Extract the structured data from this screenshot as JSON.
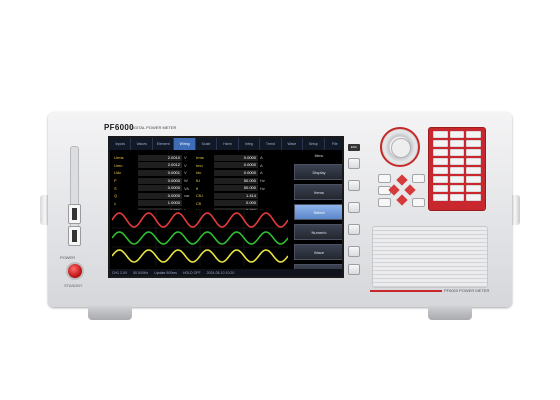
{
  "device": {
    "model": "PF6000",
    "subtitle": "DIGITAL POWER METER",
    "brand_logo": "",
    "power_label": "POWER",
    "standby_label": "STANDBY",
    "usb_label": "USB",
    "footer_model": "PF6000 POWER METER"
  },
  "screen": {
    "tabs": [
      "Inputs",
      "Values",
      "Element",
      "Wiring",
      "Scale",
      "Harm",
      "Integ",
      "Trend",
      "Wave",
      "Setup",
      "File"
    ],
    "active_tab": 3,
    "measurements": [
      {
        "label": "Urms",
        "value": "2.0010",
        "unit": "V",
        "label2": "Irms",
        "value2": "0.0000",
        "unit2": "A"
      },
      {
        "label": "Umn",
        "value": "2.0012",
        "unit": "V",
        "label2": "Imn",
        "value2": "0.0000",
        "unit2": "A"
      },
      {
        "label": "Udc",
        "value": "0.0001",
        "unit": "V",
        "label2": "Idc",
        "value2": "0.0000",
        "unit2": "A"
      },
      {
        "label": "P",
        "value": "0.0000",
        "unit": "W",
        "label2": "fU",
        "value2": "50.000",
        "unit2": "Hz"
      },
      {
        "label": "S",
        "value": "0.0000",
        "unit": "VA",
        "label2": "fI",
        "value2": "50.000",
        "unit2": "Hz"
      },
      {
        "label": "Q",
        "value": "0.0000",
        "unit": "var",
        "label2": "CfU",
        "value2": "1.414",
        "unit2": ""
      },
      {
        "label": "λ",
        "value": "1.0000",
        "unit": "",
        "label2": "CfI",
        "value2": "0.000",
        "unit2": ""
      },
      {
        "label": "φ",
        "value": "0.000",
        "unit": "°",
        "label2": "Upk",
        "value2": "2.830",
        "unit2": "V"
      }
    ],
    "side_header": "Menu",
    "side_buttons": [
      "Display",
      "Items",
      "Select",
      "Numeric",
      "Wave",
      "Trend"
    ],
    "side_active": 2,
    "side_footer": "1/2",
    "status_items": [
      "CH1 2.0V",
      "50.000Hz",
      "Update 500ms",
      "HOLD OFF",
      "2024-05-10 10:20"
    ]
  },
  "waves": [
    {
      "color": "#e23b3b",
      "amplitude": 7,
      "cycles": 6
    },
    {
      "color": "#2fbf2f",
      "amplitude": 6,
      "cycles": 6
    },
    {
      "color": "#e7e342",
      "amplitude": 6,
      "cycles": 6
    }
  ],
  "colors": {
    "accent": "#c8282d",
    "tab_active": "#3e6cb6",
    "screen_bg": "#000000"
  }
}
